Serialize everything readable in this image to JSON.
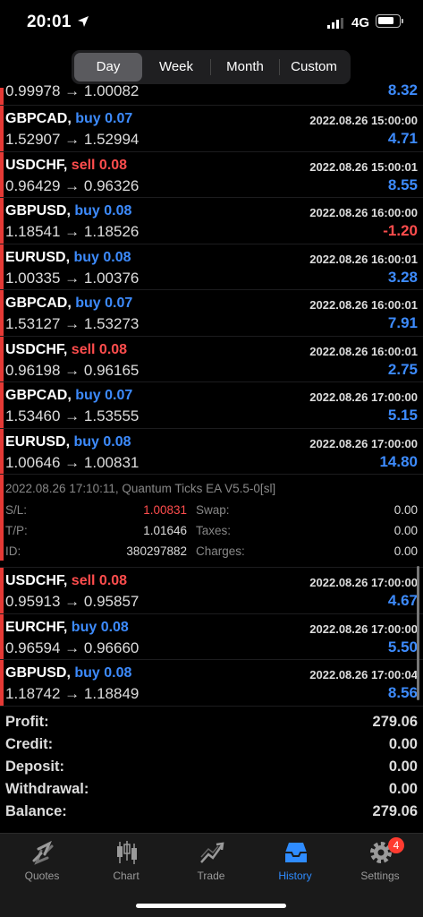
{
  "status": {
    "time": "20:01",
    "network": "4G"
  },
  "periods": [
    "Day",
    "Week",
    "Month",
    "Custom"
  ],
  "partial_row": {
    "prices": "0.99978 → 1.00082",
    "profit": "8.32"
  },
  "trades_a": [
    {
      "symbol": "GBPCAD,",
      "side": "buy 0.07",
      "type": "buy",
      "date": "2022.08.26 15:00:00",
      "prices": "1.52907 → 1.52994",
      "profit": "4.71",
      "sign": "pos"
    },
    {
      "symbol": "USDCHF,",
      "side": "sell 0.08",
      "type": "sell",
      "date": "2022.08.26 15:00:01",
      "prices": "0.96429 → 0.96326",
      "profit": "8.55",
      "sign": "pos"
    },
    {
      "symbol": "GBPUSD,",
      "side": "buy 0.08",
      "type": "buy",
      "date": "2022.08.26 16:00:00",
      "prices": "1.18541 → 1.18526",
      "profit": "-1.20",
      "sign": "neg"
    },
    {
      "symbol": "EURUSD,",
      "side": "buy 0.08",
      "type": "buy",
      "date": "2022.08.26 16:00:01",
      "prices": "1.00335 → 1.00376",
      "profit": "3.28",
      "sign": "pos"
    },
    {
      "symbol": "GBPCAD,",
      "side": "buy 0.07",
      "type": "buy",
      "date": "2022.08.26 16:00:01",
      "prices": "1.53127 → 1.53273",
      "profit": "7.91",
      "sign": "pos"
    },
    {
      "symbol": "USDCHF,",
      "side": "sell 0.08",
      "type": "sell",
      "date": "2022.08.26 16:00:01",
      "prices": "0.96198 → 0.96165",
      "profit": "2.75",
      "sign": "pos"
    },
    {
      "symbol": "GBPCAD,",
      "side": "buy 0.07",
      "type": "buy",
      "date": "2022.08.26 17:00:00",
      "prices": "1.53460 → 1.53555",
      "profit": "5.15",
      "sign": "pos"
    },
    {
      "symbol": "EURUSD,",
      "side": "buy 0.08",
      "type": "buy",
      "date": "2022.08.26 17:00:00",
      "prices": "1.00646 → 1.00831",
      "profit": "14.80",
      "sign": "pos"
    }
  ],
  "details": {
    "comment": "2022.08.26 17:10:11, Quantum Ticks EA V5.5-0[sl]",
    "sl_label": "S/L:",
    "sl_value": "1.00831",
    "tp_label": "T/P:",
    "tp_value": "1.01646",
    "id_label": "ID:",
    "id_value": "380297882",
    "swap_label": "Swap:",
    "swap_value": "0.00",
    "taxes_label": "Taxes:",
    "taxes_value": "0.00",
    "charges_label": "Charges:",
    "charges_value": "0.00"
  },
  "trades_b": [
    {
      "symbol": "USDCHF,",
      "side": "sell 0.08",
      "type": "sell",
      "date": "2022.08.26 17:00:00",
      "prices": "0.95913 → 0.95857",
      "profit": "4.67",
      "sign": "pos"
    },
    {
      "symbol": "EURCHF,",
      "side": "buy 0.08",
      "type": "buy",
      "date": "2022.08.26 17:00:00",
      "prices": "0.96594 → 0.96660",
      "profit": "5.50",
      "sign": "pos"
    },
    {
      "symbol": "GBPUSD,",
      "side": "buy 0.08",
      "type": "buy",
      "date": "2022.08.26 17:00:04",
      "prices": "1.18742 → 1.18849",
      "profit": "8.56",
      "sign": "pos"
    }
  ],
  "summary": [
    {
      "label": "Profit:",
      "value": "279.06"
    },
    {
      "label": "Credit:",
      "value": "0.00"
    },
    {
      "label": "Deposit:",
      "value": "0.00"
    },
    {
      "label": "Withdrawal:",
      "value": "0.00"
    },
    {
      "label": "Balance:",
      "value": "279.06"
    }
  ],
  "tabs": [
    {
      "label": "Quotes",
      "icon": "quotes-icon"
    },
    {
      "label": "Chart",
      "icon": "chart-icon"
    },
    {
      "label": "Trade",
      "icon": "trade-icon"
    },
    {
      "label": "History",
      "icon": "history-icon"
    },
    {
      "label": "Settings",
      "icon": "settings-icon",
      "badge": "4"
    }
  ],
  "colors": {
    "buy": "#3d8bfd",
    "sell": "#ff4d4d",
    "accent": "#e53935",
    "active_tab": "#2f8cff"
  }
}
